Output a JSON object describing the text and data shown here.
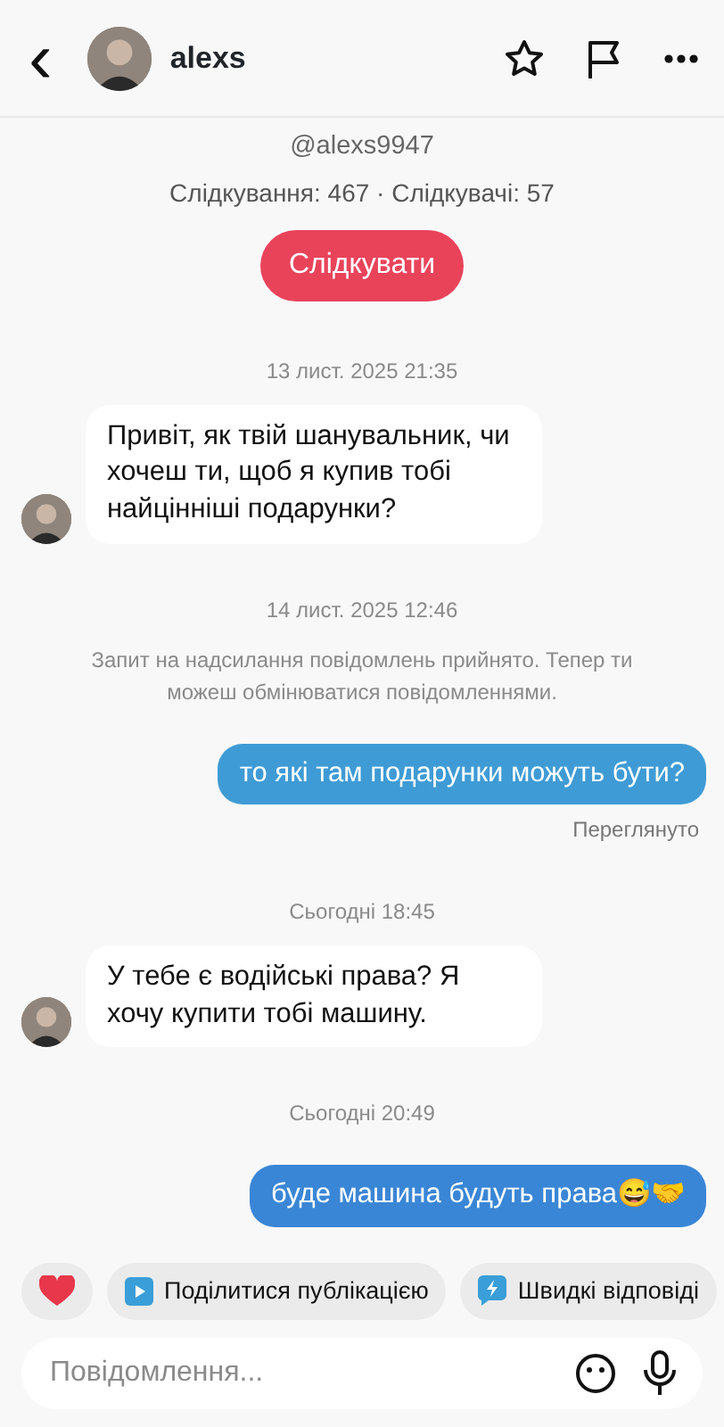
{
  "header": {
    "back": "‹",
    "name": "alexs"
  },
  "profile": {
    "handle": "@alexs9947",
    "stats": "Слідкування: 467 · Слідкувачі: 57",
    "follow_button": "Слідкувати"
  },
  "messages": [
    {
      "kind": "date",
      "text": "13 лист. 2025 21:35"
    },
    {
      "kind": "incoming",
      "text": "Привіт, як твій шанувальник, чи хочеш ти, щоб я купив тобі найцінніші подарунки?"
    },
    {
      "kind": "date",
      "text": "14 лист. 2025 12:46"
    },
    {
      "kind": "system",
      "text": "Запит на надсилання повідомлень прийнято. Тепер ти можеш обмінюватися повідомленнями."
    },
    {
      "kind": "outgoing",
      "text": "то які там подарунки можуть бути?"
    },
    {
      "kind": "status",
      "text": "Переглянуто"
    },
    {
      "kind": "date",
      "text": "Сьогодні 18:45"
    },
    {
      "kind": "incoming",
      "text": "У тебе є водійські права? Я хочу купити тобі машину."
    },
    {
      "kind": "date",
      "text": "Сьогодні 20:49"
    },
    {
      "kind": "outgoing",
      "text": "буде машина будуть права😅🤝"
    }
  ],
  "chips": [
    {
      "kind": "heart"
    },
    {
      "kind": "share",
      "label": "Поділитися публікацією"
    },
    {
      "kind": "quick",
      "label": "Швидкі відповіді"
    }
  ],
  "composer": {
    "placeholder": "Повідомлення..."
  }
}
